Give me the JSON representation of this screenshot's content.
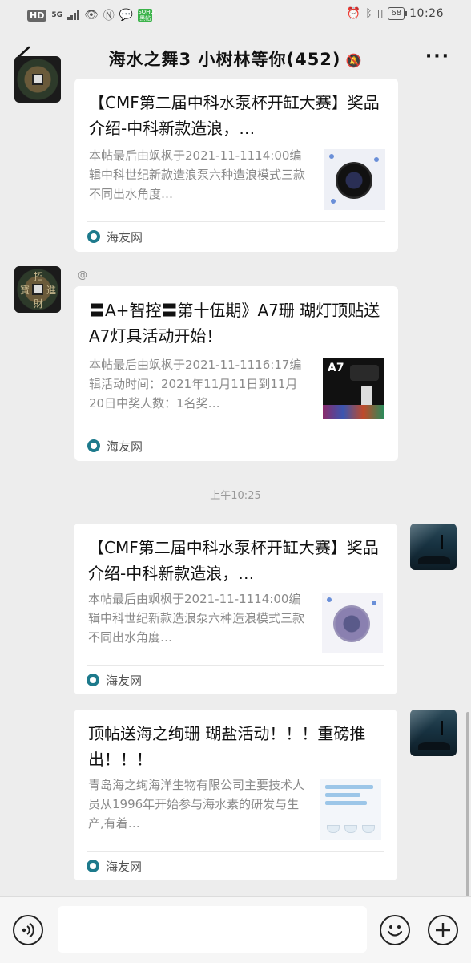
{
  "status_bar": {
    "left_badges": [
      "HD",
      "5G"
    ],
    "app_badge": "SOHO\n黑帖",
    "battery": "68",
    "time": "10:26"
  },
  "header": {
    "title": "海水之舞3 小树林等你(452)",
    "mute_icon": "bell-slash-icon",
    "more_label": "···"
  },
  "messages": [
    {
      "side": "left",
      "title": "【CMF第二届中科水泵杯开缸大赛】奖品介绍-中科新款造浪，…",
      "desc": "本帖最后由飒枫于2021-11-1114:00编辑中科世纪新款造浪泵六种造浪模式三款不同出水角度…",
      "source": "海友网"
    },
    {
      "side": "left",
      "at": "@",
      "title": "〓A+智控〓第十伍期》A7珊 瑚灯顶贴送A7灯具活动开始！",
      "desc": "本帖最后由飒枫于2021-11-1116:17编辑活动时间：2021年11月11日到11月20日中奖人数：1名奖…",
      "thumb_label": "A7",
      "source": "海友网"
    },
    {
      "side": "right",
      "title": "【CMF第二届中科水泵杯开缸大赛】奖品介绍-中科新款造浪，…",
      "desc": "本帖最后由飒枫于2021-11-1114:00编辑中科世纪新款造浪泵六种造浪模式三款不同出水角度…",
      "source": "海友网"
    },
    {
      "side": "right",
      "title": "顶帖送海之绚珊 瑚盐活动！！！重磅推出！！！",
      "desc": "青岛海之绚海洋生物有限公司主要技术人员从1996年开始参与海水素的研发与生产,有着…",
      "source": "海友网"
    }
  ],
  "timestamp": "上午10:25"
}
